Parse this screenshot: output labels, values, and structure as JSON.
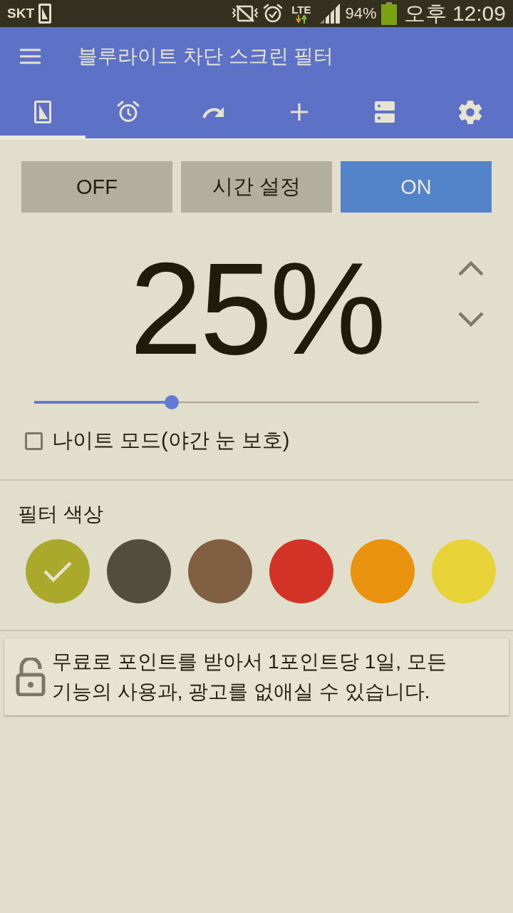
{
  "status_bar": {
    "carrier": "SKT",
    "network": "LTE",
    "battery": "94%",
    "time": "오후 12:09"
  },
  "app_bar": {
    "title": "블루라이트 차단 스크린 필터"
  },
  "tabs": [
    {
      "kind": "screen",
      "selected": true
    },
    {
      "kind": "alarm",
      "selected": false
    },
    {
      "kind": "redo",
      "selected": false
    },
    {
      "kind": "add",
      "selected": false
    },
    {
      "kind": "storage",
      "selected": false
    },
    {
      "kind": "settings",
      "selected": false
    }
  ],
  "mode_buttons": [
    {
      "label": "OFF",
      "selected": false
    },
    {
      "label": "시간 설정",
      "selected": false
    },
    {
      "label": "ON",
      "selected": true
    }
  ],
  "intensity": {
    "reading": "25%",
    "level": 0.31
  },
  "night_mode": {
    "label": "나이트 모드(야간 눈 보호)",
    "checked": false
  },
  "filter_color": {
    "heading": "필터 색상",
    "swatches": [
      {
        "color": "#aba92c",
        "selected": true
      },
      {
        "color": "#524e3d",
        "selected": false
      },
      {
        "color": "#805f42",
        "selected": false
      },
      {
        "color": "#d33226",
        "selected": false
      },
      {
        "color": "#e8920d",
        "selected": false
      },
      {
        "color": "#e7d337",
        "selected": false
      }
    ]
  },
  "promo": {
    "text": "무료로 포인트를 받아서 1포인트당 1일, 모든 기능의 사용과, 광고를 없애실 수 있습니다."
  }
}
